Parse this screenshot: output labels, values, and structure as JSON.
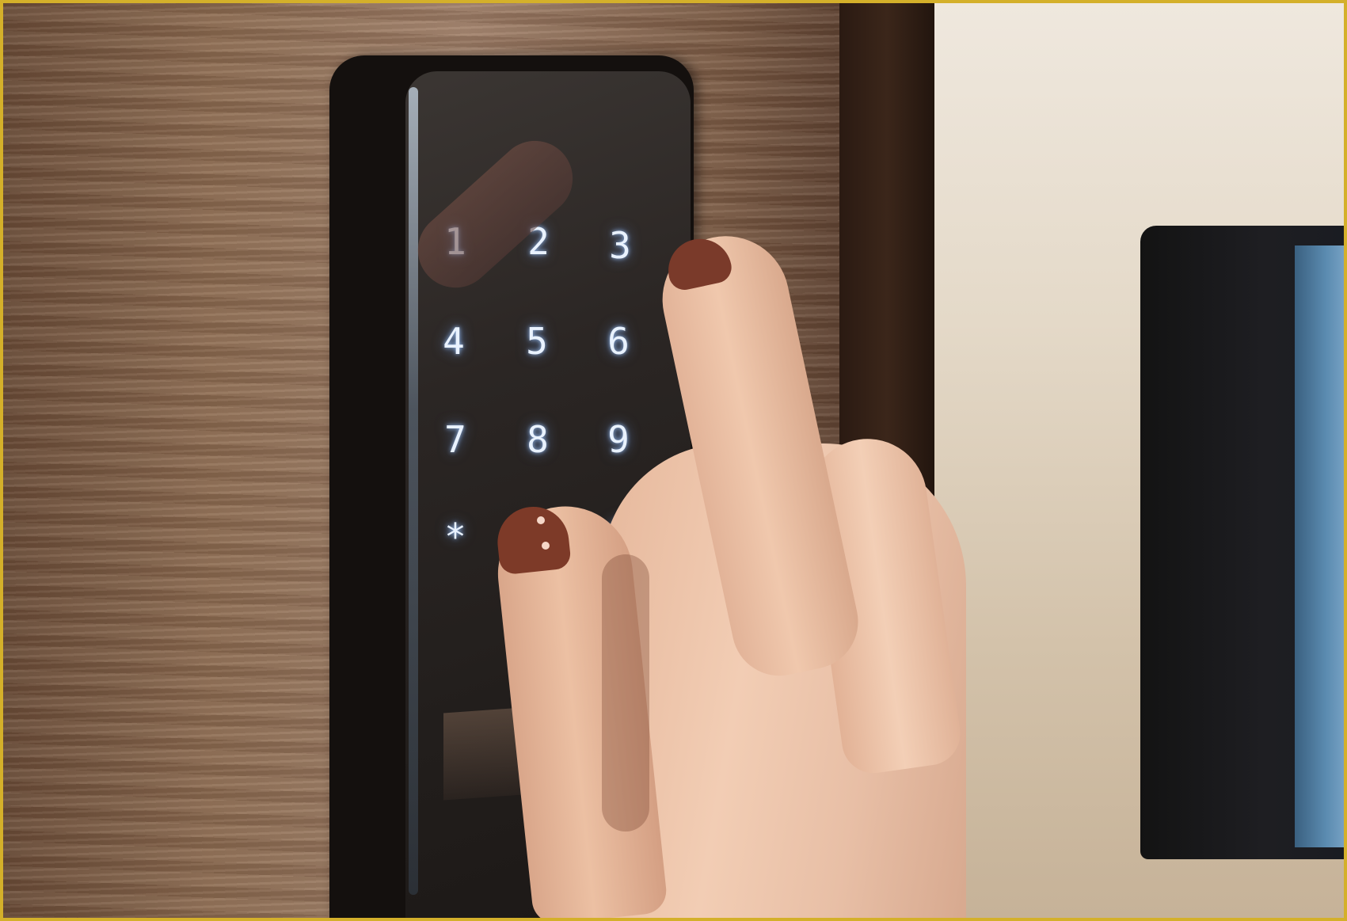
{
  "keypad": {
    "keys": [
      "1",
      "2",
      "3",
      "4",
      "5",
      "6",
      "7",
      "8",
      "9",
      "*",
      "#"
    ],
    "glow_color": "#9cc4ff"
  },
  "colors": {
    "frame_border": "#d4b02a",
    "door_wood": "#8d6c52",
    "lock_body": "#14100e",
    "nail_polish": "#7d3a28",
    "skin": "#ecc0a3"
  }
}
